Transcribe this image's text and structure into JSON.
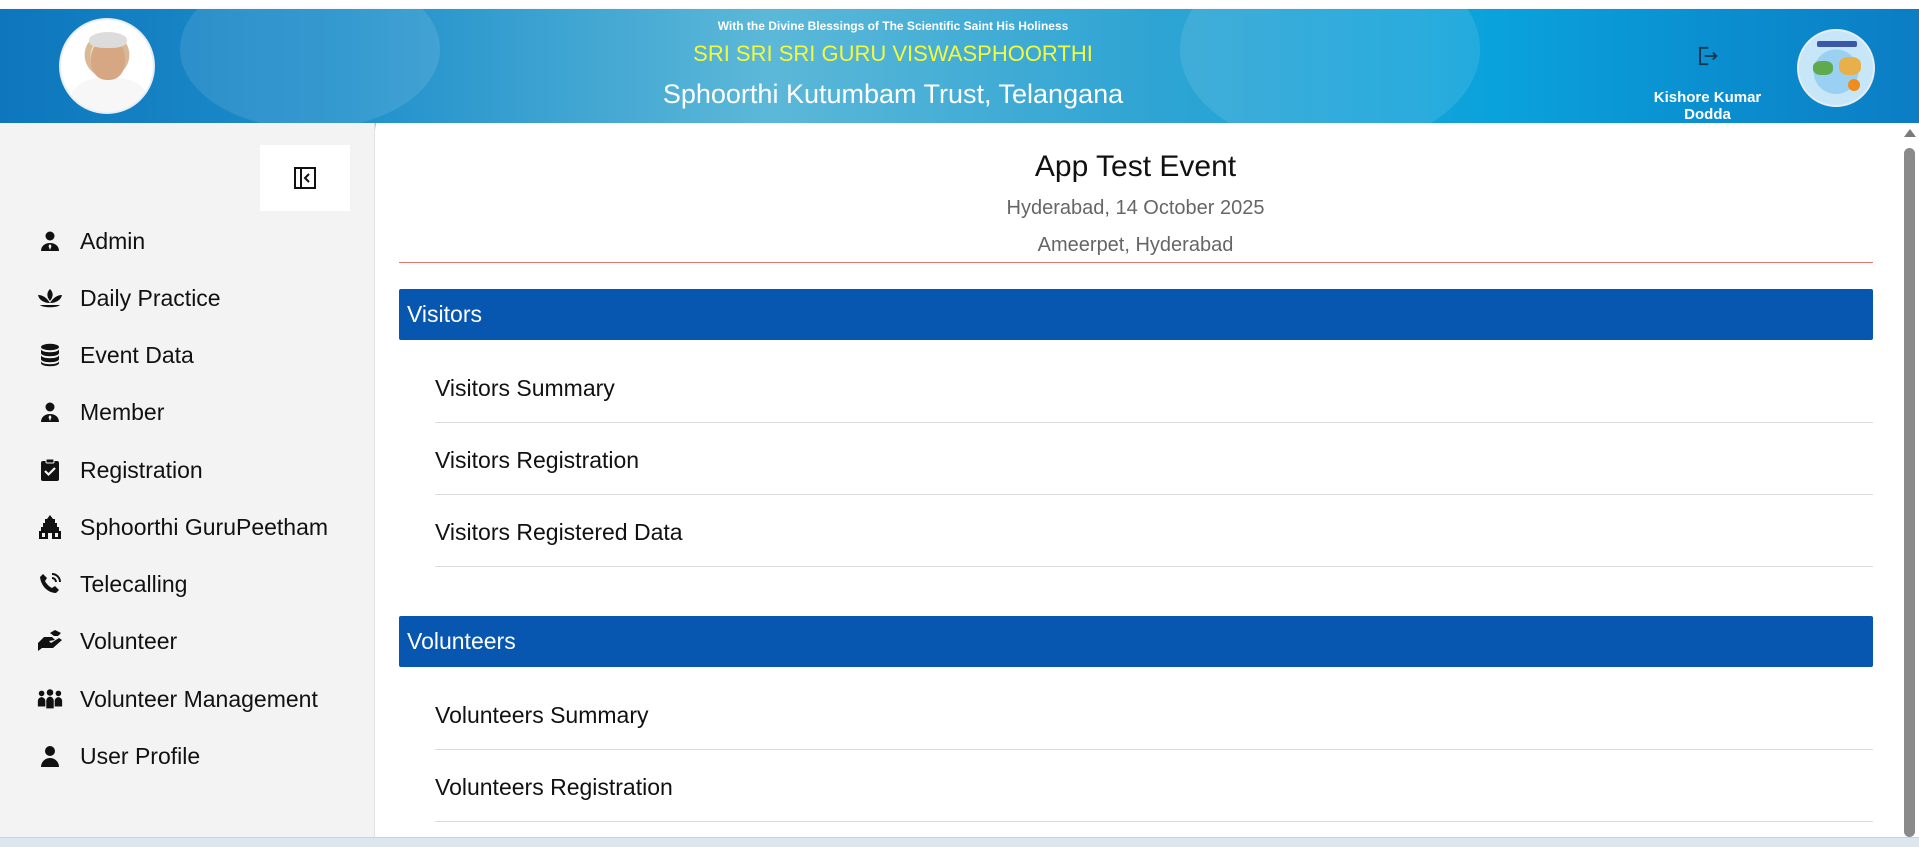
{
  "header": {
    "blessing": "With the Divine Blessings of The Scientific Saint His Holiness",
    "guru_name": "SRI SRI SRI GURU VISWASPHOORTHI",
    "trust_name": "Sphoorthi Kutumbam Trust, Telangana",
    "user_name": "Kishore Kumar Dodda",
    "icons": [
      "guru-photo",
      "logout-icon",
      "org-logo"
    ]
  },
  "sidebar": {
    "collapse_icon": "sidebar-collapse-icon",
    "items": [
      {
        "label": "Admin",
        "icon": "admin-icon"
      },
      {
        "label": "Daily Practice",
        "icon": "lotus-icon"
      },
      {
        "label": "Event Data",
        "icon": "database-icon"
      },
      {
        "label": "Member",
        "icon": "member-icon"
      },
      {
        "label": "Registration",
        "icon": "clipboard-check-icon"
      },
      {
        "label": "Sphoorthi GuruPeetham",
        "icon": "temple-icon"
      },
      {
        "label": "Telecalling",
        "icon": "phone-icon"
      },
      {
        "label": "Volunteer",
        "icon": "helping-hand-icon"
      },
      {
        "label": "Volunteer Management",
        "icon": "people-group-icon"
      },
      {
        "label": "User Profile",
        "icon": "user-icon"
      }
    ]
  },
  "main": {
    "event_title": "App Test Event",
    "event_date": "Hyderabad, 14 October 2025",
    "event_venue": "Ameerpet, Hyderabad",
    "sections": [
      {
        "title": "Visitors",
        "items": [
          "Visitors Summary",
          "Visitors Registration",
          "Visitors Registered Data"
        ]
      },
      {
        "title": "Volunteers",
        "items": [
          "Volunteers Summary",
          "Volunteers Registration"
        ]
      }
    ]
  },
  "colors": {
    "header_gradient_start": "#0d76bd",
    "header_gradient_end": "#0b7dc4",
    "guru_name_yellow": "#f4f93c",
    "section_bar_blue": "#0757b1",
    "divider_red": "#e57373",
    "sidebar_bg": "#f3f3f3"
  }
}
